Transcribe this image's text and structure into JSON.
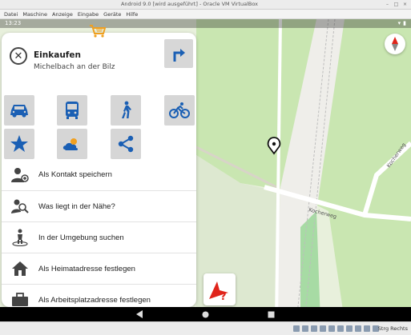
{
  "window": {
    "title": "Android 9.0 [wird ausgeführt] - Oracle VM VirtualBox",
    "min_glyph": "–",
    "max_glyph": "□",
    "close_glyph": "×"
  },
  "menubar": [
    "Datei",
    "Maschine",
    "Anzeige",
    "Eingabe",
    "Geräte",
    "Hilfe"
  ],
  "android_status": {
    "time": "13:23",
    "wifi_glyph": "▾",
    "battery_glyph": "▮"
  },
  "place": {
    "name": "Einkaufen",
    "locality": "Michelbach an der Bilz",
    "close_glyph": "✕"
  },
  "actions": [
    {
      "name": "car",
      "icon": "car-icon"
    },
    {
      "name": "bus",
      "icon": "bus-icon"
    },
    {
      "name": "walk",
      "icon": "pedestrian-icon"
    },
    {
      "name": "bicycle",
      "icon": "bicycle-icon"
    },
    {
      "name": "favorite",
      "icon": "star-icon"
    },
    {
      "name": "weather",
      "icon": "weather-icon"
    },
    {
      "name": "share",
      "icon": "share-icon"
    }
  ],
  "list": [
    {
      "label": "Als Kontakt speichern",
      "icon": "add-contact-icon"
    },
    {
      "label": "Was liegt in der Nähe?",
      "icon": "person-search-icon"
    },
    {
      "label": "In der Umgebung suchen",
      "icon": "person-location-icon"
    },
    {
      "label": "Als Heimatadresse festlegen",
      "icon": "home-icon"
    },
    {
      "label": "Als Arbeitsplatzadresse festlegen",
      "icon": "briefcase-icon"
    }
  ],
  "map": {
    "street_labels": [
      "Kocherweg",
      "Kocherweg"
    ]
  },
  "colors": {
    "accent_blue": "#1a5fb4",
    "map_green": "#c9e6b1",
    "map_light": "#e8f0dc",
    "rail_green": "#a7dba4",
    "nav_red": "#e0241b"
  },
  "host": {
    "hostkey_label": "Strg Rechts"
  }
}
